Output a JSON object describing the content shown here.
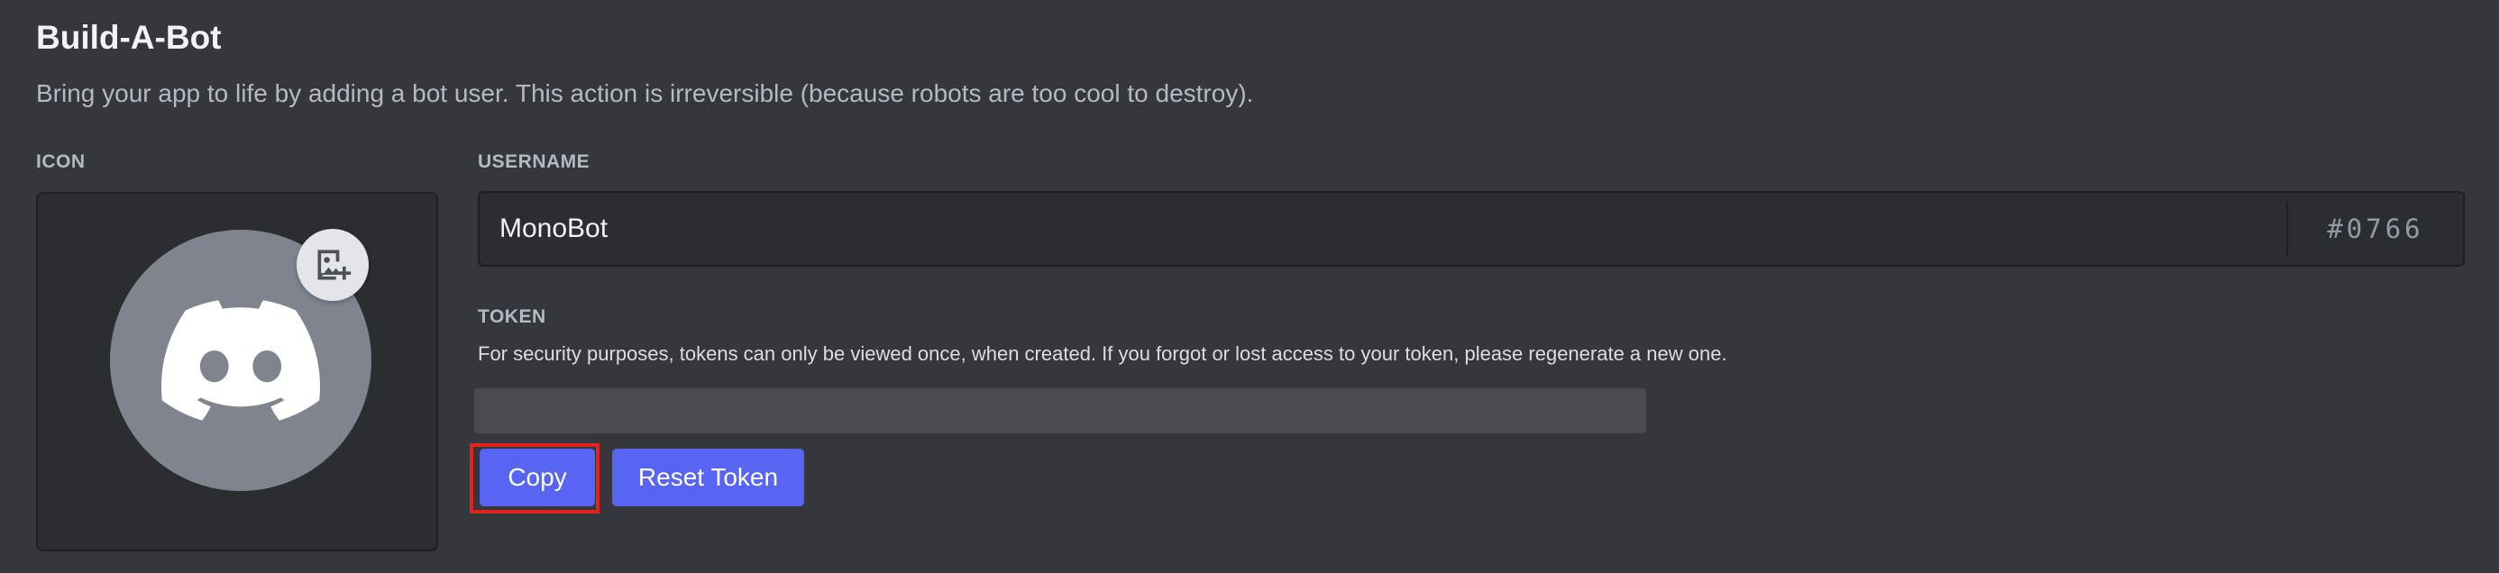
{
  "section": {
    "title": "Build-A-Bot",
    "description": "Bring your app to life by adding a bot user. This action is irreversible (because robots are too cool to destroy)."
  },
  "icon_panel": {
    "label": "ICON",
    "avatar_icon": "discord-logo-icon",
    "upload_icon": "image-add-icon"
  },
  "username": {
    "label": "USERNAME",
    "value": "MonoBot",
    "discriminator": "#0766"
  },
  "token": {
    "label": "TOKEN",
    "help_text": "For security purposes, tokens can only be viewed once, when created. If you forgot or lost access to your token, please regenerate a new one.",
    "value": ""
  },
  "buttons": {
    "copy_label": "Copy",
    "reset_label": "Reset Token"
  },
  "colors": {
    "background": "#36373d",
    "panel": "#2b2d31",
    "brand": "#5865f2",
    "avatar": "#80848e",
    "highlight": "#e0231c"
  }
}
